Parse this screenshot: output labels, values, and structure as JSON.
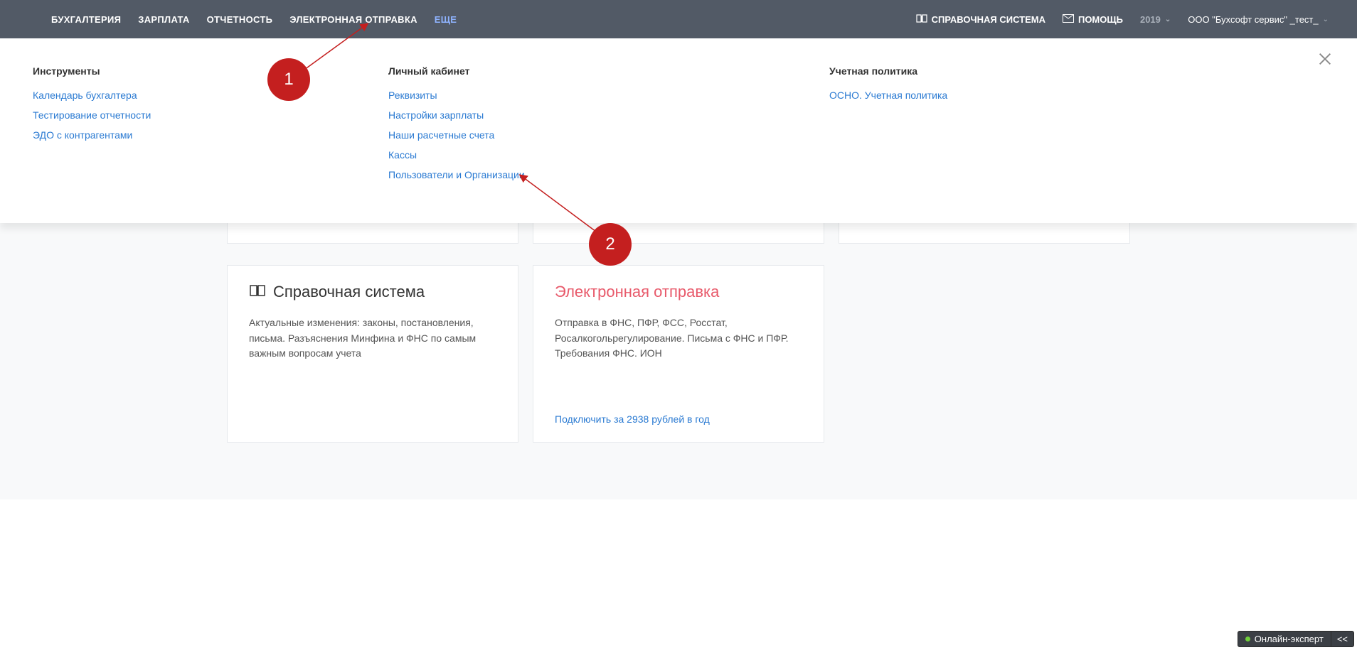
{
  "topnav": {
    "left": [
      {
        "label": "БУХГАЛТЕРИЯ",
        "active": false
      },
      {
        "label": "ЗАРПЛАТА",
        "active": false
      },
      {
        "label": "ОТЧЕТНОСТЬ",
        "active": false
      },
      {
        "label": "ЭЛЕКТРОННАЯ ОТПРАВКА",
        "active": false
      },
      {
        "label": "ЕЩЕ",
        "active": true
      }
    ],
    "right": {
      "reference": "СПРАВОЧНАЯ СИСТЕМА",
      "help": "ПОМОЩЬ",
      "year": "2019",
      "org": "ООО \"Бухсофт сервис\" _тест_"
    }
  },
  "mega": {
    "cols": [
      {
        "title": "Инструменты",
        "links": [
          "Календарь бухгалтера",
          "Тестирование отчетности",
          "ЭДО с контрагентами"
        ]
      },
      {
        "title": "Личный кабинет",
        "links": [
          "Реквизиты",
          "Настройки зарплаты",
          "Наши расчетные счета",
          "Кассы",
          "Пользователи и Организации"
        ]
      },
      {
        "title": "Учетная политика",
        "links": [
          "ОСНО. Учетная политика"
        ]
      }
    ]
  },
  "annotations": {
    "a1": "1",
    "a2": "2"
  },
  "cards": [
    {
      "title": "Справочная система",
      "icon": "book",
      "desc": "Актуальные изменения: законы, постановления, письма. Разъяснения Минфина и ФНС по самым важным вопросам учета",
      "action": ""
    },
    {
      "title": "Электронная отправка",
      "icon": "",
      "pink": true,
      "desc": "Отправка в ФНС, ПФР, ФСС, Росстат, Росалкогольрегулирование. Письма с ФНС и ПФР. Требования ФНС. ИОН",
      "action": "Подключить за 2938 рублей в год"
    }
  ],
  "online_expert": {
    "label": "Онлайн-эксперт",
    "collapse": "<<"
  }
}
